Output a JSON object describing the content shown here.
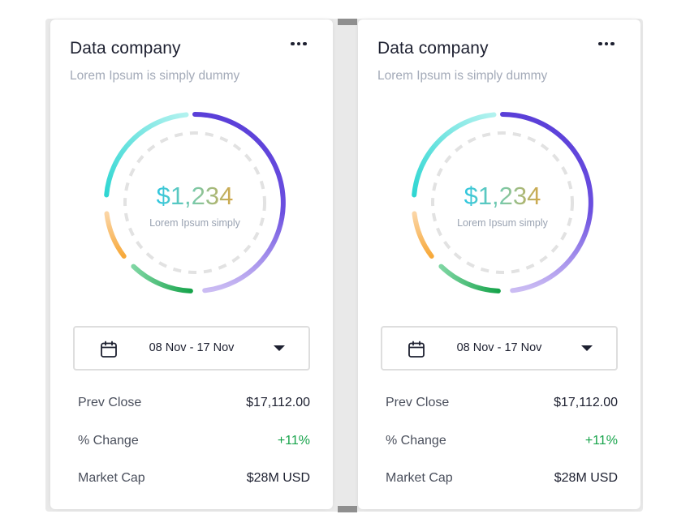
{
  "colors": {
    "ring_purple": "#5a3fd8",
    "ring_purple_light": "#cbbcf3",
    "ring_cyan": "#2fd6d2",
    "ring_cyan_light": "#b2f2ef",
    "ring_orange": "#f7a93a",
    "ring_orange_light": "#fbd5a5",
    "ring_green": "#16a34a",
    "ring_green_light": "#7fd6a3",
    "ring_track": "#e2e2e2",
    "value_gradient": [
      "#2fc7e0",
      "#7cc9a8",
      "#d3a84a"
    ],
    "positive": "#16a34a"
  },
  "cards": [
    {
      "title": "Data company",
      "subtitle": "Lorem Ipsum is simply dummy",
      "menu_icon": "more-horizontal-icon",
      "donut": {
        "value": "$1,234",
        "label": "Lorem Ipsum simply"
      },
      "date_range": {
        "icon": "calendar-icon",
        "value": "08 Nov - 17 Nov",
        "dropdown_icon": "caret-down-icon"
      },
      "stats": [
        {
          "label": "Prev Close",
          "value": "$17,112.00"
        },
        {
          "label": "% Change",
          "value": "+11%"
        },
        {
          "label": "Market Cap",
          "value": "$28M USD"
        }
      ]
    },
    {
      "title": "Data company",
      "subtitle": "Lorem Ipsum is simply dummy",
      "menu_icon": "more-horizontal-icon",
      "donut": {
        "value": "$1,234",
        "label": "Lorem Ipsum simply"
      },
      "date_range": {
        "icon": "calendar-icon",
        "value": "08 Nov - 17 Nov",
        "dropdown_icon": "caret-down-icon"
      },
      "stats": [
        {
          "label": "Prev Close",
          "value": "$17,112.00"
        },
        {
          "label": "% Change",
          "value": "+11%"
        },
        {
          "label": "Market Cap",
          "value": "$28M USD"
        }
      ]
    }
  ]
}
